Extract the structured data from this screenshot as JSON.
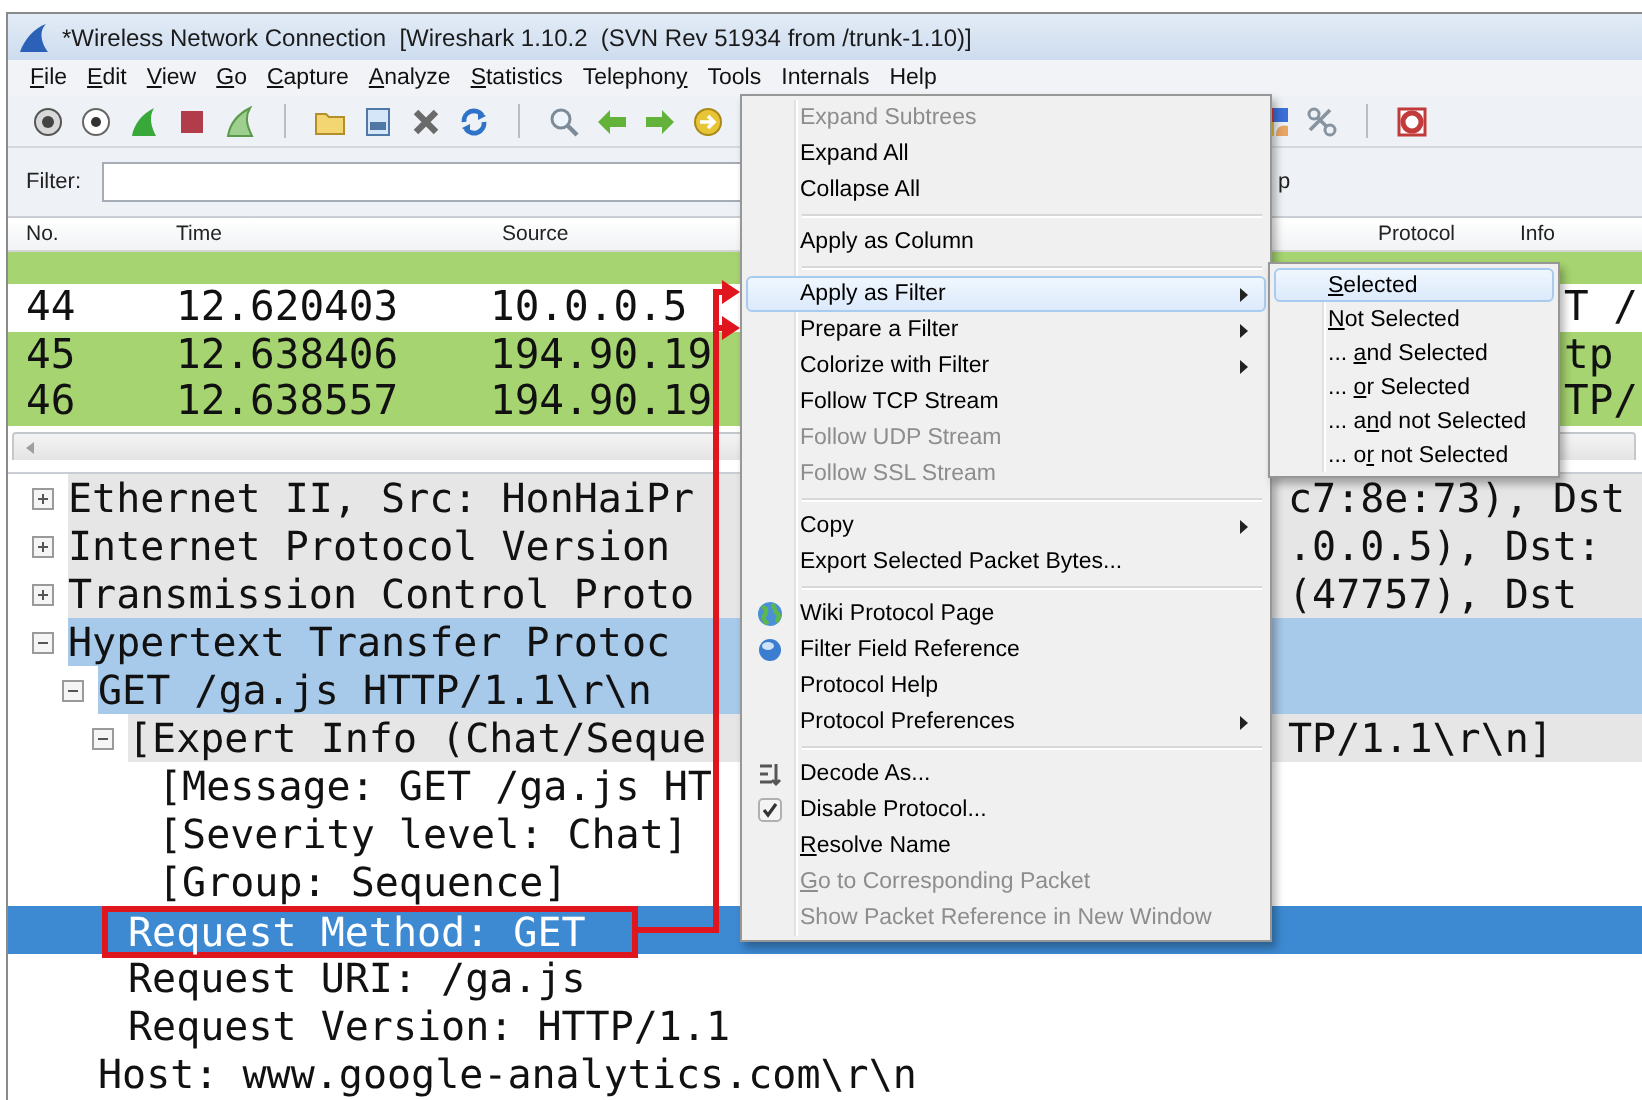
{
  "window": {
    "title": "*Wireless Network Connection  [Wireshark 1.10.2  (SVN Rev 51934 from /trunk-1.10)]"
  },
  "menu_bar": [
    {
      "key": "F",
      "rest": "ile"
    },
    {
      "key": "E",
      "rest": "dit"
    },
    {
      "key": "V",
      "rest": "iew"
    },
    {
      "key": "G",
      "rest": "o"
    },
    {
      "key": "C",
      "rest": "apture"
    },
    {
      "key": "A",
      "rest": "nalyze"
    },
    {
      "key": "S",
      "rest": "tatistics"
    },
    {
      "lead": "Telephon",
      "key": "y"
    },
    {
      "label": "Tools"
    },
    {
      "label": "Internals"
    },
    {
      "label": "Help"
    }
  ],
  "filter_bar": {
    "label": "Filter:",
    "right_text": "p"
  },
  "packet_list": {
    "columns": [
      {
        "label": "No."
      },
      {
        "label": "Time"
      },
      {
        "label": "Source"
      },
      {
        "label": "Protocol"
      },
      {
        "label": "Info"
      }
    ],
    "rows": [
      {
        "color": "#a6d470"
      },
      {
        "no": "44",
        "time": "12.620403",
        "source": "10.0.0.5",
        "info": "T /",
        "color": "#ffffff"
      },
      {
        "no": "45",
        "time": "12.638406",
        "source": "194.90.19",
        "info": "tp",
        "color": "#a6d470"
      },
      {
        "no": "46",
        "time": "12.638557",
        "source": "194.90.19",
        "info": "TP/",
        "color": "#a6d470"
      }
    ]
  },
  "packet_details": {
    "rows": [
      {
        "kind": "summary",
        "text": "Ethernet II, Src: HonHaiPr",
        "tail": "c7:8e:73), Dst",
        "expanded": false,
        "selected": false
      },
      {
        "kind": "summary",
        "text": "Internet Protocol Version",
        "tail": ".0.0.5), Dst:",
        "expanded": false,
        "selected": false
      },
      {
        "kind": "summary",
        "text": "Transmission Control Proto",
        "tail": "(47757), Dst",
        "expanded": false,
        "selected": false
      },
      {
        "kind": "path",
        "text": "Hypertext Transfer Protoc",
        "expanded": true,
        "selected": false,
        "children": [
          {
            "kind": "path",
            "text": "GET /ga.js HTTP/1.1\\r\\n",
            "expanded": true,
            "selected": false,
            "children": [
              {
                "kind": "summary",
                "text": "[Expert Info (Chat/Seque",
                "tail": "TP/1.1\\r\\n]",
                "expanded": true,
                "selected": false,
                "children": [
                  {
                    "kind": "field",
                    "text": "[Message: GET /ga.js HT",
                    "selected": false
                  },
                  {
                    "kind": "field",
                    "text": "[Severity level: Chat]",
                    "selected": false
                  },
                  {
                    "kind": "field",
                    "text": "[Group: Sequence]",
                    "selected": false
                  }
                ]
              },
              {
                "kind": "field",
                "text": "Request Method: GET",
                "selected": true
              },
              {
                "kind": "field",
                "text": "Request URI: /ga.js",
                "selected": false
              },
              {
                "kind": "field",
                "text": "Request Version: HTTP/1.1",
                "selected": false
              }
            ]
          },
          {
            "kind": "field",
            "text": "Host: www.google-analytics.com\\r\\n",
            "selected": false
          }
        ]
      }
    ]
  },
  "context_menu": {
    "items": [
      {
        "kind": "item",
        "label": "Expand Subtrees",
        "disabled": true,
        "selected": false,
        "submenu": false
      },
      {
        "kind": "item",
        "label": "Expand All",
        "disabled": false,
        "selected": false,
        "submenu": false
      },
      {
        "kind": "item",
        "label": "Collapse All",
        "disabled": false,
        "selected": false,
        "submenu": false
      },
      {
        "kind": "separator"
      },
      {
        "kind": "item",
        "label": "Apply as Column",
        "disabled": false,
        "selected": false,
        "submenu": false
      },
      {
        "kind": "separator"
      },
      {
        "kind": "item",
        "label": "Apply as Filter",
        "disabled": false,
        "selected": true,
        "submenu": true
      },
      {
        "kind": "item",
        "label": "Prepare a Filter",
        "disabled": false,
        "selected": false,
        "submenu": true
      },
      {
        "kind": "item",
        "label": "Colorize with Filter",
        "disabled": false,
        "selected": false,
        "submenu": true
      },
      {
        "kind": "item",
        "label": "Follow TCP Stream",
        "disabled": false,
        "selected": false,
        "submenu": false
      },
      {
        "kind": "item",
        "label": "Follow UDP Stream",
        "disabled": true,
        "selected": false,
        "submenu": false
      },
      {
        "kind": "item",
        "label": "Follow SSL Stream",
        "disabled": true,
        "selected": false,
        "submenu": false
      },
      {
        "kind": "separator"
      },
      {
        "kind": "item",
        "label": "Copy",
        "disabled": false,
        "selected": false,
        "submenu": true
      },
      {
        "kind": "item",
        "label": "Export Selected Packet Bytes...",
        "disabled": false,
        "selected": false,
        "submenu": false
      },
      {
        "kind": "separator"
      },
      {
        "kind": "wiki",
        "label": "Wiki Protocol Page",
        "disabled": false,
        "selected": false,
        "submenu": false
      },
      {
        "kind": "reference",
        "label": "Filter Field Reference",
        "disabled": false,
        "selected": false,
        "submenu": false
      },
      {
        "kind": "item",
        "label": "Protocol Help",
        "disabled": false,
        "selected": false,
        "submenu": false
      },
      {
        "kind": "item",
        "label": "Protocol Preferences",
        "disabled": false,
        "selected": false,
        "submenu": true
      },
      {
        "kind": "separator"
      },
      {
        "kind": "decode",
        "label": "Decode As...",
        "disabled": false,
        "selected": false,
        "submenu": false
      },
      {
        "kind": "toggle",
        "label": "Disable Protocol...",
        "disabled": false,
        "selected": false,
        "submenu": false
      },
      {
        "kind": "item",
        "key": "R",
        "rest": "esolve Name",
        "disabled": false,
        "selected": false,
        "submenu": false
      },
      {
        "kind": "item",
        "key": "G",
        "rest": "o to Corresponding Packet",
        "disabled": true,
        "selected": false,
        "submenu": false
      },
      {
        "kind": "item",
        "label": "Show Packet Reference in New Window",
        "disabled": true,
        "selected": false,
        "submenu": false
      }
    ],
    "submenu": [
      {
        "key": "S",
        "rest": "elected",
        "selected": true
      },
      {
        "key": "N",
        "rest": "ot Selected",
        "selected": false
      },
      {
        "lead": "... ",
        "key": "a",
        "rest": "nd Selected",
        "selected": false
      },
      {
        "lead": "... ",
        "key": "o",
        "rest": "r Selected",
        "selected": false
      },
      {
        "lead": "... a",
        "key": "n",
        "rest": "d not Selected",
        "selected": false
      },
      {
        "lead": "... o",
        "key": "r",
        "rest": " not Selected",
        "selected": false
      }
    ]
  }
}
